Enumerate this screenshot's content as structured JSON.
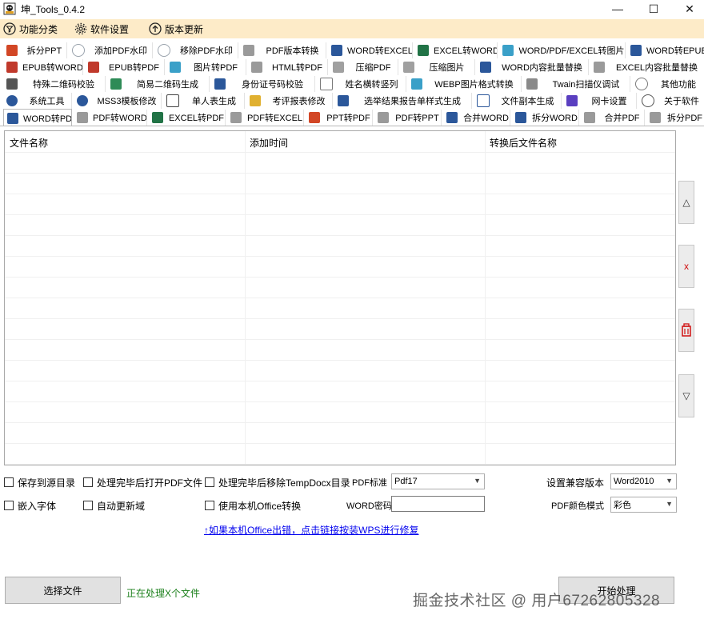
{
  "window": {
    "title": "坤_Tools_0.4.2",
    "controls": {
      "minimize": "—",
      "maximize": "☐",
      "close": "✕"
    }
  },
  "menu": [
    {
      "label": "功能分类",
      "icon": "filter-circle-icon"
    },
    {
      "label": "软件设置",
      "icon": "gear-icon"
    },
    {
      "label": "版本更新",
      "icon": "arrow-up-circle-icon"
    }
  ],
  "tab_rows": [
    [
      {
        "label": "拆分PPT",
        "icon": "ppt-icon",
        "color": "#d24625"
      },
      {
        "label": "添加PDF水印",
        "icon": "watermark-icon",
        "color": "#9aa3ad"
      },
      {
        "label": "移除PDF水印",
        "icon": "watermark-icon",
        "color": "#9aa3ad"
      },
      {
        "label": "PDF版本转换",
        "icon": "pdf-icon",
        "color": "#8a8a8a"
      },
      {
        "label": "WORD转EXCEL",
        "icon": "word-icon",
        "color": "#2b579a"
      },
      {
        "label": "EXCEL转WORD",
        "icon": "excel-icon",
        "color": "#217346"
      },
      {
        "label": "WORD/PDF/EXCEL转图片",
        "icon": "image-icon",
        "color": "#3aa0c8"
      },
      {
        "label": "WORD转EPUB",
        "icon": "word-icon",
        "color": "#2b579a"
      }
    ],
    [
      {
        "label": "EPUB转WORD",
        "icon": "epub-icon",
        "color": "#c0392b"
      },
      {
        "label": "EPUB转PDF",
        "icon": "epub-icon",
        "color": "#c0392b"
      },
      {
        "label": "图片转PDF",
        "icon": "image-icon",
        "color": "#3aa0c8"
      },
      {
        "label": "HTML转PDF",
        "icon": "pdf-icon",
        "color": "#8a8a8a"
      },
      {
        "label": "压缩PDF",
        "icon": "compress-icon",
        "color": "#8a8a8a"
      },
      {
        "label": "压缩图片",
        "icon": "compress-icon",
        "color": "#8a8a8a"
      },
      {
        "label": "WORD内容批量替换",
        "icon": "word-icon",
        "color": "#2b579a"
      },
      {
        "label": "EXCEL内容批量替换",
        "icon": "excel-icon",
        "color": "#8a8a8a"
      }
    ],
    [
      {
        "label": "特殊二维码校验",
        "icon": "qrcode-icon",
        "color": "#555555"
      },
      {
        "label": "简易二维码生成",
        "icon": "qrcode-icon",
        "color": "#2e8b57"
      },
      {
        "label": "身份证号码校验",
        "icon": "id-card-icon",
        "color": "#2b579a"
      },
      {
        "label": "姓名横转竖列",
        "icon": "text-direction-icon",
        "color": "#7a7a7a"
      },
      {
        "label": "WEBP图片格式转换",
        "icon": "image-icon",
        "color": "#3aa0c8"
      },
      {
        "label": "Twain扫描仪调试",
        "icon": "scanner-icon",
        "color": "#7a7a7a"
      },
      {
        "label": "其他功能",
        "icon": "more-icon",
        "color": "#7a7a7a"
      }
    ],
    [
      {
        "label": "系统工具",
        "icon": "gear-icon",
        "color": "#2b579a"
      },
      {
        "label": "MSS3模板修改",
        "icon": "gear-icon",
        "color": "#2b579a"
      },
      {
        "label": "单人表生成",
        "icon": "document-icon",
        "color": "#444444"
      },
      {
        "label": "考评报表修改",
        "icon": "document-edit-icon",
        "color": "#c08a00"
      },
      {
        "label": "选举结果报告单样式生成",
        "icon": "report-icon",
        "color": "#2b579a"
      },
      {
        "label": "文件副本生成",
        "icon": "document-icon",
        "color": "#2b579a"
      },
      {
        "label": "网卡设置",
        "icon": "network-icon",
        "color": "#5a3fc0"
      },
      {
        "label": "关于软件",
        "icon": "info-icon",
        "color": "#555555"
      }
    ],
    [
      {
        "label": "WORD转PDF",
        "icon": "word-icon",
        "color": "#2b579a"
      },
      {
        "label": "PDF转WORD",
        "icon": "pdf-icon",
        "color": "#8a8a8a"
      },
      {
        "label": "EXCEL转PDF",
        "icon": "excel-icon",
        "color": "#217346"
      },
      {
        "label": "PDF转EXCEL",
        "icon": "pdf-icon",
        "color": "#8a8a8a"
      },
      {
        "label": "PPT转PDF",
        "icon": "ppt-icon",
        "color": "#d24625"
      },
      {
        "label": "PDF转PPT",
        "icon": "pdf-icon",
        "color": "#8a8a8a"
      },
      {
        "label": "合并WORD",
        "icon": "word-icon",
        "color": "#2b579a"
      },
      {
        "label": "拆分WORD",
        "icon": "word-icon",
        "color": "#2b579a"
      },
      {
        "label": "合并PDF",
        "icon": "pdf-icon",
        "color": "#8a8a8a"
      },
      {
        "label": "拆分PDF",
        "icon": "pdf-icon",
        "color": "#8a8a8a"
      }
    ]
  ],
  "active_tab": "WORD转PDF",
  "list": {
    "columns": [
      "文件名称",
      "添加时间",
      "转换后文件名称"
    ],
    "rows": []
  },
  "side_buttons": [
    {
      "label": "△",
      "icon": "move-up-icon"
    },
    {
      "label": "x",
      "icon": "remove-icon",
      "color": "#d01010"
    },
    {
      "label": "",
      "icon": "clear-list-icon",
      "color": "#d01010"
    },
    {
      "label": "▽",
      "icon": "move-down-icon"
    }
  ],
  "options": {
    "save_to_source": {
      "label": "保存到源目录",
      "checked": false
    },
    "open_pdf_after": {
      "label": "处理完毕后打开PDF文件",
      "checked": false
    },
    "remove_tempdocx": {
      "label": "处理完毕后移除TempDocx目录",
      "checked": false
    },
    "embed_fonts": {
      "label": "嵌入字体",
      "checked": false
    },
    "auto_update_fields": {
      "label": "自动更新域",
      "checked": false
    },
    "use_local_office": {
      "label": "使用本机Office转换",
      "checked": false
    },
    "pdf_standard": {
      "label": "PDF标准",
      "value": "Pdf17"
    },
    "word_password": {
      "label": "WORD密码",
      "value": ""
    },
    "compat_version": {
      "label": "设置兼容版本",
      "value": "Word2010"
    },
    "pdf_color_mode": {
      "label": "PDF颜色模式",
      "value": "彩色"
    }
  },
  "help_link": "↑如果本机Office出错，点击链接按装WPS进行修复",
  "buttons": {
    "select_files": "选择文件",
    "start": "开始处理"
  },
  "status": "正在处理X个文件",
  "watermark": "掘金技术社区 @ 用户6726280532​8"
}
